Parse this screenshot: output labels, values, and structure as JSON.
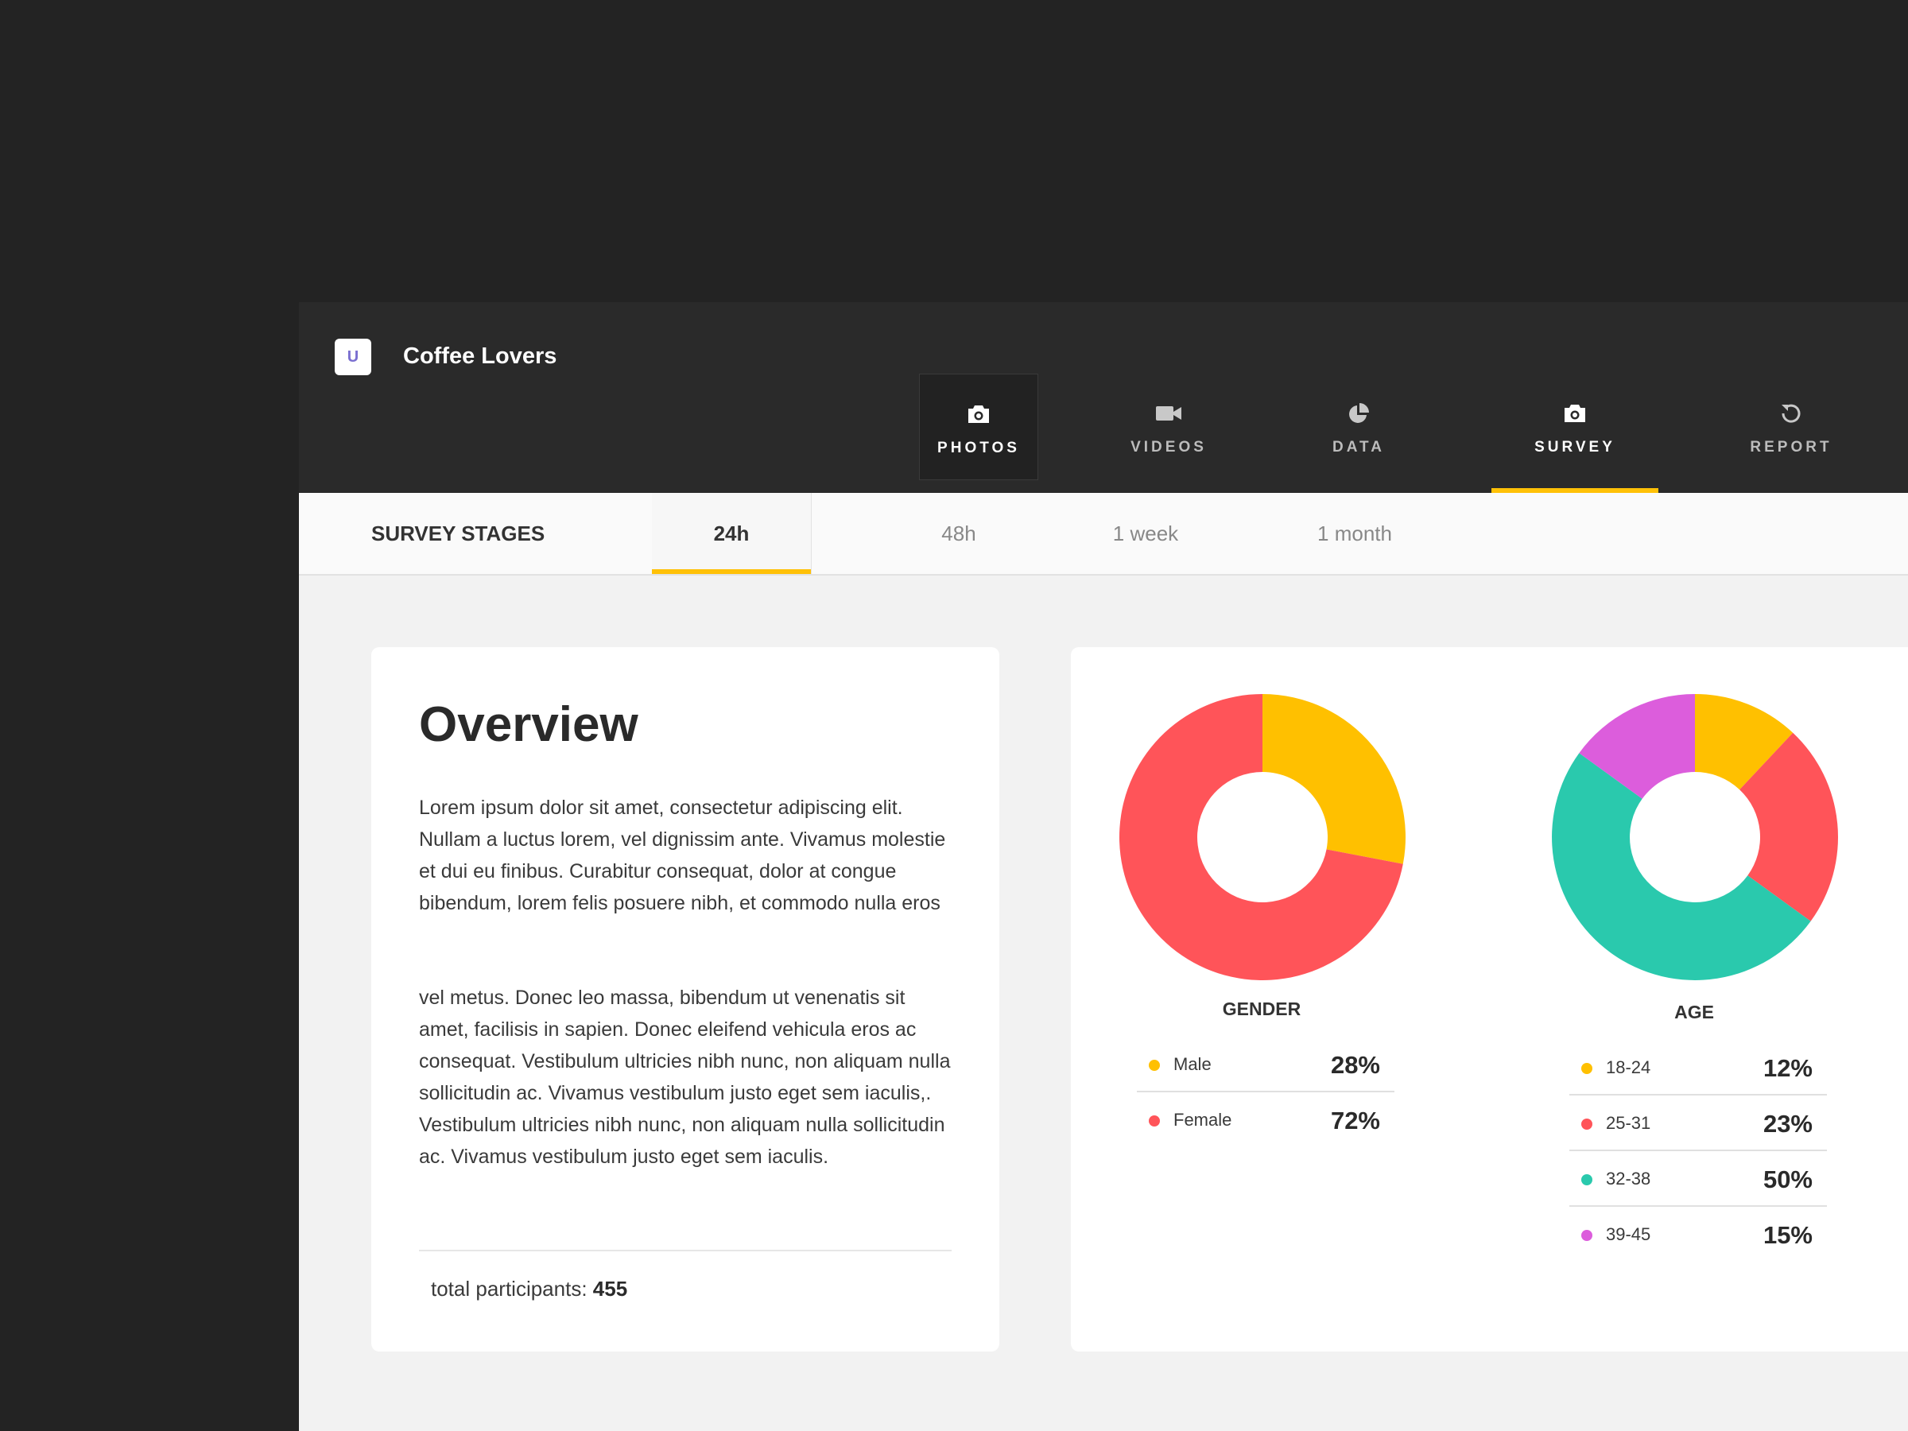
{
  "app": {
    "logo_text": "U",
    "title": "Coffee Lovers"
  },
  "nav": [
    {
      "label": "PHOTOS",
      "icon": "camera-icon"
    },
    {
      "label": "VIDEOS",
      "icon": "video-camera-icon"
    },
    {
      "label": "DATA",
      "icon": "pie-chart-icon"
    },
    {
      "label": "SURVEY",
      "icon": "camera-icon"
    },
    {
      "label": "REPORT",
      "icon": "refresh-icon"
    }
  ],
  "stages": {
    "label": "SURVEY STAGES",
    "tabs": [
      "24h",
      "48h",
      "1 week",
      "1 month"
    ],
    "active": "24h"
  },
  "overview": {
    "title": "Overview",
    "paragraph1": "Lorem ipsum dolor sit amet, consectetur adipiscing elit. Nullam a luctus lorem, vel dignissim ante. Vivamus molestie et dui eu finibus. Curabitur consequat, dolor at congue bibendum, lorem felis posuere nibh, et commodo nulla eros",
    "paragraph2": "vel metus. Donec leo massa, bibendum ut venenatis sit amet, facilisis in sapien. Donec eleifend vehicula eros ac consequat. Vestibulum ultricies nibh nunc, non aliquam nulla sollicitudin ac. Vivamus vestibulum justo eget sem iaculis,. Vestibulum ultricies nibh nunc, non aliquam nulla sollicitudin ac. Vivamus vestibulum justo eget sem iaculis.",
    "participants_label": "total participants:",
    "participants_value": "455"
  },
  "chart_data": [
    {
      "type": "pie",
      "title": "GENDER",
      "categories": [
        "Male",
        "Female"
      ],
      "values": [
        28,
        72
      ],
      "labels": [
        "28%",
        "72%"
      ],
      "colors": [
        "#ffc000",
        "#ff5459"
      ]
    },
    {
      "type": "pie",
      "title": "AGE",
      "categories": [
        "18-24",
        "25-31",
        "32-38",
        "39-45"
      ],
      "values": [
        12,
        23,
        50,
        15
      ],
      "labels": [
        "12%",
        "23%",
        "50%",
        "15%"
      ],
      "colors": [
        "#ffc000",
        "#ff5459",
        "#2ac9ad",
        "#dc5ddc"
      ]
    }
  ]
}
